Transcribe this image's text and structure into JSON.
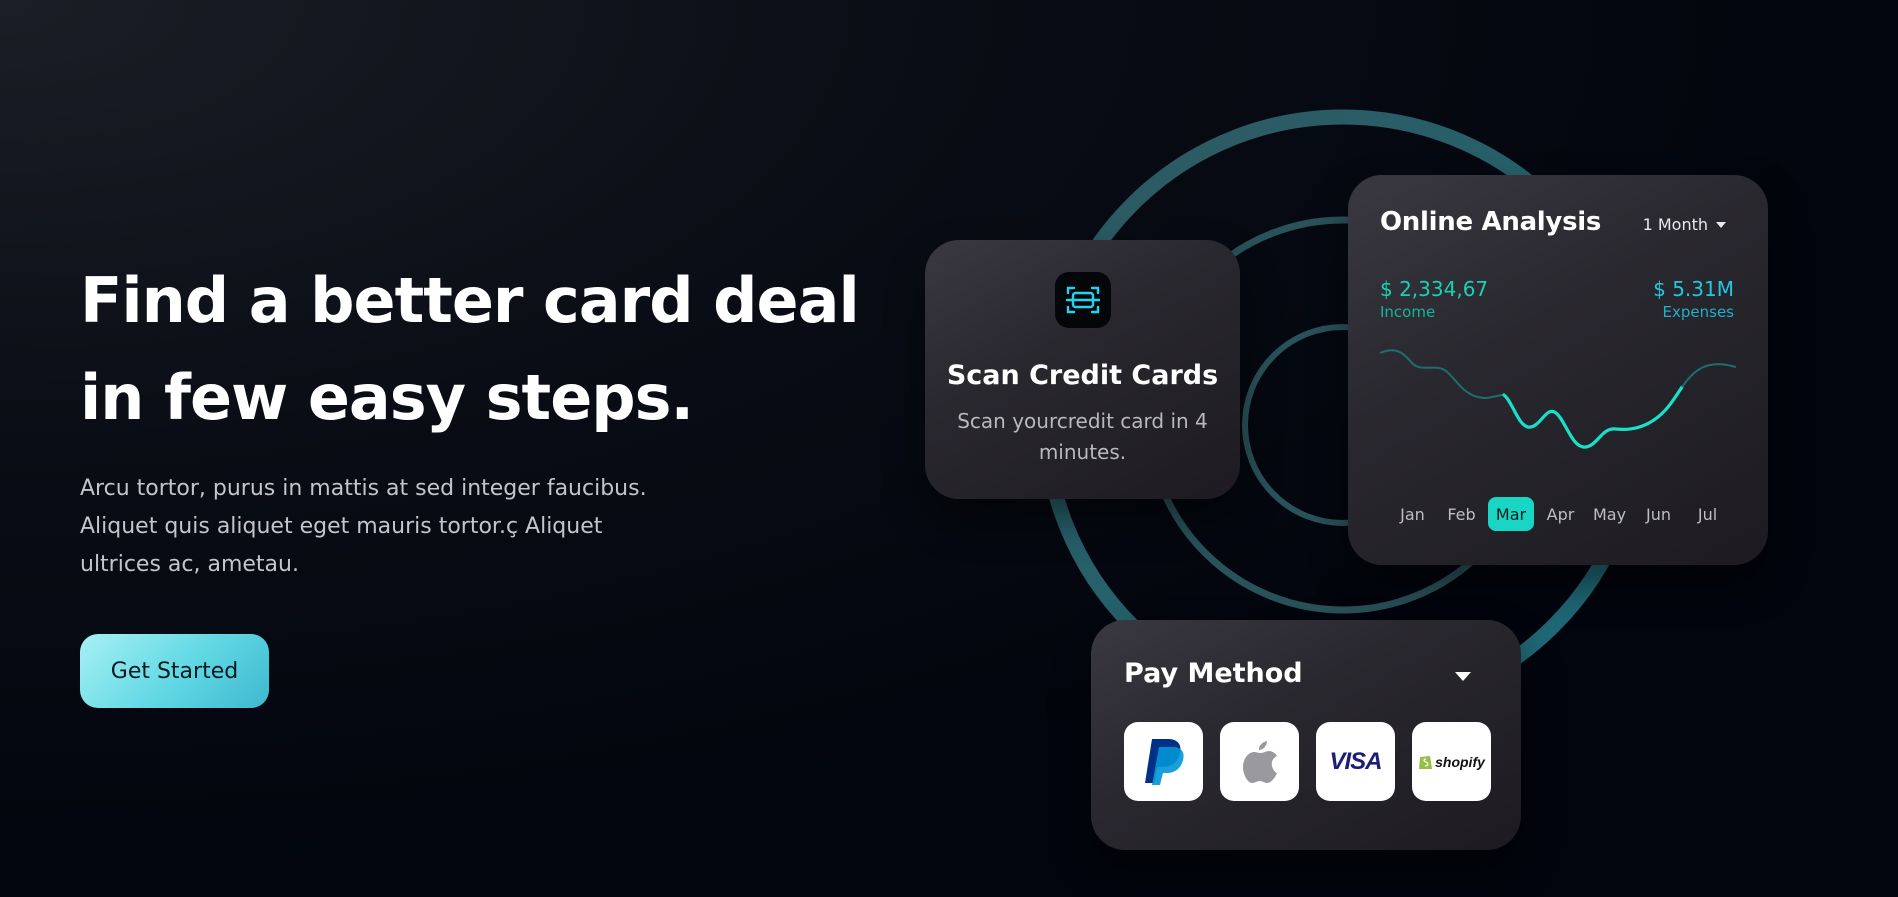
{
  "hero": {
    "title_line1": "Find a better card deal",
    "title_line2": "in few easy steps.",
    "description": "Arcu tortor, purus in mattis at sed integer faucibus. Aliquet quis aliquet eget mauris tortor.ç Aliquet ultrices ac, ametau.",
    "cta_label": "Get Started"
  },
  "scan_card": {
    "icon": "scan-card-icon",
    "title": "Scan Credit Cards",
    "subtitle": "Scan yourcredit card in 4 minutes."
  },
  "analysis": {
    "title": "Online Analysis",
    "period": "1 Month",
    "income_value": "$ 2,334,67",
    "income_label": "Income",
    "expenses_value": "$ 5.31M",
    "expenses_label": "Expenses",
    "months": [
      "Jan",
      "Feb",
      "Mar",
      "Apr",
      "May",
      "Jun",
      "Jul"
    ],
    "active_month": "Mar"
  },
  "pay_method": {
    "title": "Pay Method",
    "logos": [
      "paypal-icon",
      "apple-icon",
      "visa-icon",
      "shopify-icon"
    ],
    "visa_text": "VISA",
    "shopify_text": "shopify"
  },
  "colors": {
    "accent_teal": "#19d6c4",
    "cta_gradient_start": "#a7f1f4",
    "cta_gradient_end": "#3fb8cf",
    "ring": "#2b5a60"
  }
}
